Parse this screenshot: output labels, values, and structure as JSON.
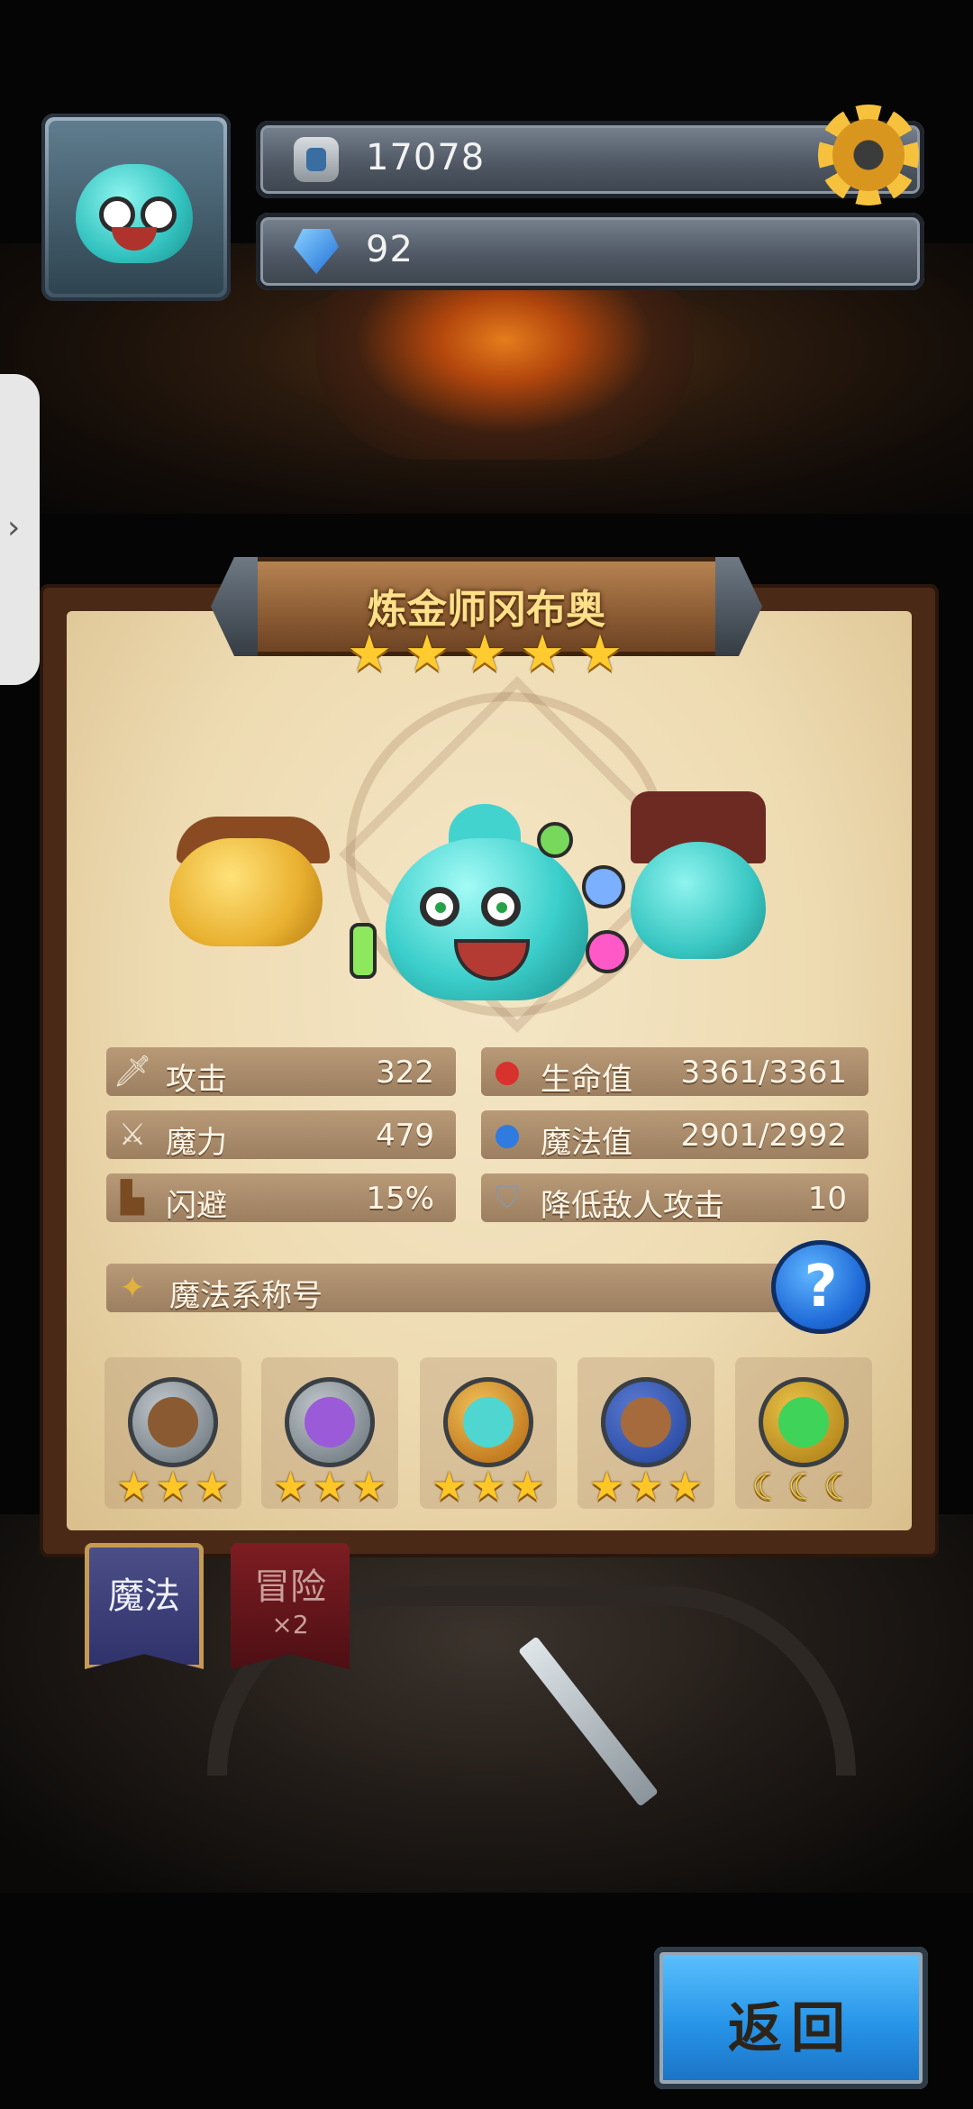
{
  "hud": {
    "stone_count": "17078",
    "gem_count": "92",
    "icons": {
      "stone": "stone-tablet-icon",
      "gem": "blue-gem-icon",
      "settings": "gear-icon"
    },
    "colors": {
      "gear": "#f6c23e",
      "bar": "#4f5864"
    }
  },
  "hero": {
    "name": "炼金师冈布奥",
    "stars": [
      "★",
      "★",
      "★",
      "★",
      "★"
    ]
  },
  "stats": {
    "attack": {
      "label": "攻击",
      "value": "322",
      "icon": "sword-icon"
    },
    "magic_power": {
      "label": "魔力",
      "value": "479",
      "icon": "staff-icon"
    },
    "dodge": {
      "label": "闪避",
      "value": "15%",
      "icon": "boot-icon"
    },
    "hp": {
      "label": "生命值",
      "value": "3361/3361",
      "icon": "red-potion-icon"
    },
    "mp": {
      "label": "魔法值",
      "value": "2901/2992",
      "icon": "blue-potion-icon"
    },
    "reduce_attack": {
      "label": "降低敌人攻击",
      "value": "10",
      "icon": "shield-icon"
    }
  },
  "title_bar": {
    "label": "魔法系称号",
    "icon": "wand-badge-icon",
    "help": "?"
  },
  "skills": [
    {
      "icon": "horn-emblem-icon",
      "stars": [
        "★",
        "★",
        "★"
      ]
    },
    {
      "icon": "crystal-shield-emblem-icon",
      "stars": [
        "★",
        "★",
        "★"
      ]
    },
    {
      "icon": "potion-emblem-icon",
      "stars": [
        "★",
        "★",
        "★"
      ]
    },
    {
      "icon": "rock-laurel-emblem-icon",
      "stars": [
        "★",
        "★",
        "★"
      ]
    },
    {
      "icon": "portal-crown-emblem-icon",
      "stars": [
        "☾",
        "☾",
        "☾"
      ]
    }
  ],
  "tabs": {
    "magic": "魔法",
    "adventure": "冒险",
    "adventure_mult": "×2"
  },
  "back_button": "返回",
  "edge_tab_glyph": "›"
}
